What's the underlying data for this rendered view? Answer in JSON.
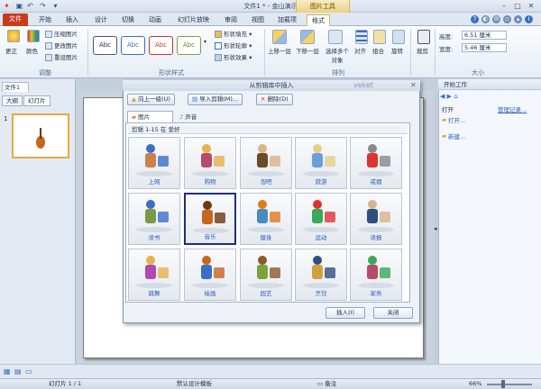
{
  "window": {
    "title": "文件1 * - 金山演示",
    "tool_context": "图片工具"
  },
  "tabs": [
    "文件",
    "开始",
    "插入",
    "设计",
    "切换",
    "动画",
    "幻灯片放映",
    "审阅",
    "视图",
    "加载项",
    "格式"
  ],
  "ribbon": {
    "adjust": {
      "label": "调整",
      "change": "更正",
      "color": "颜色",
      "compress": "压缩图片",
      "change_pic": "更改图片",
      "reset": "重设图片"
    },
    "styles": {
      "label": "形状样式",
      "sample": "Abc",
      "fill": "形状填充",
      "outline": "形状轮廓",
      "effects": "形状效果"
    },
    "arrange": {
      "label": "排列",
      "forward": "上移一层",
      "backward": "下移一层",
      "selection": "选择多个对象",
      "align": "对齐",
      "group": "组合",
      "rotate": "旋转"
    },
    "crop": "裁剪",
    "size": {
      "label": "大小",
      "height_label": "高度:",
      "height_value": "6.51 厘米",
      "width_label": "宽度:",
      "width_value": "5.46 厘米"
    }
  },
  "left_pane": {
    "doc_tab": "文件1",
    "tabs": [
      "大纲",
      "幻灯片"
    ],
    "slide_number": "1"
  },
  "right_pane": {
    "title": "开始工作",
    "open_label": "打开",
    "manage": "管理记录...",
    "open_link": "打开...",
    "new_link": "新建..."
  },
  "dialog": {
    "title": "从剪辑库中插入",
    "watermark": "veket",
    "up_button": "向上一级(U)",
    "import_button": "导入剪辑(M)...",
    "delete_button": "删除(D)",
    "tabs": [
      "图片",
      "声音"
    ],
    "breadcrumb": "剪辑 1-15 在 爱好",
    "items": [
      "上网",
      "购物",
      "泡吧",
      "旅游",
      "戒烟",
      "读书",
      "音乐",
      "健身",
      "运动",
      "读报",
      "跳舞",
      "绘画",
      "园艺",
      "烹饪",
      "家务"
    ],
    "insert_button": "插入(I)",
    "close_button": "关闭"
  },
  "status": {
    "slide": "幻灯片 1 / 1",
    "template": "默认设计模板",
    "notes": "备注",
    "zoom": "66%"
  },
  "colors": {
    "file_tab": "#c83b1c",
    "accent": "#2b5fbf",
    "selected_border": "#1c2f7a"
  }
}
